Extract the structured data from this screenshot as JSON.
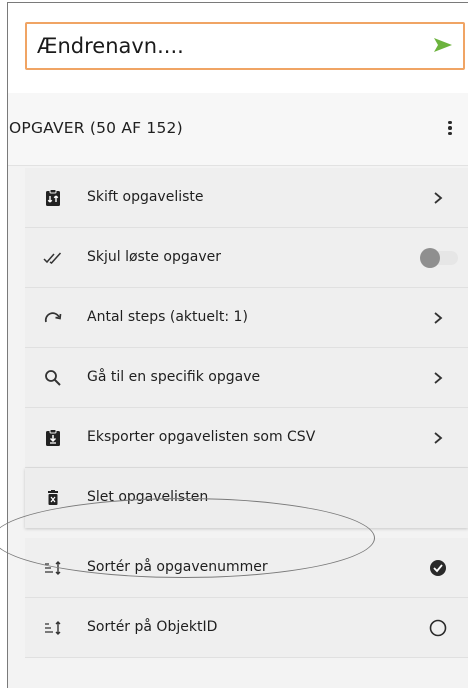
{
  "rename": {
    "value": "Ændrenavn....",
    "send_icon": "send-arrow-icon",
    "accent": "#f0a464",
    "send_color": "#6cb33e"
  },
  "section": {
    "title": "OPGAVER (50 AF 152)",
    "menu_icon": "kebab-menu-icon"
  },
  "menu": {
    "items": [
      {
        "label": "Skift opgaveliste",
        "icon": "clipboard-switch-icon",
        "trailing": "chevron"
      },
      {
        "label": "Skjul løste opgaver",
        "icon": "double-check-icon",
        "trailing": "toggle",
        "toggle_on": false
      },
      {
        "label": "Antal steps (aktuelt: 1)",
        "icon": "redo-arc-icon",
        "trailing": "chevron"
      },
      {
        "label": "Gå til en specifik opgave",
        "icon": "search-icon",
        "trailing": "chevron"
      },
      {
        "label": "Eksporter opgavelisten som CSV",
        "icon": "clipboard-download-icon",
        "trailing": "chevron"
      },
      {
        "label": "Slet opgavelisten",
        "icon": "trash-icon",
        "trailing": "none"
      },
      {
        "label": "Sortér på opgavenummer",
        "icon": "sort-icon",
        "trailing": "radio",
        "selected": true
      },
      {
        "label": "Sortér på ObjektID",
        "icon": "sort-icon",
        "trailing": "radio",
        "selected": false
      }
    ]
  }
}
